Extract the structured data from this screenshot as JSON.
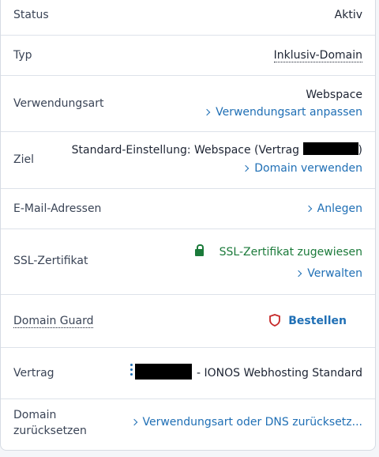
{
  "rows": {
    "status": {
      "label": "Status",
      "value": "Aktiv"
    },
    "typ": {
      "label": "Typ",
      "value": "Inklusiv-Domain"
    },
    "verwendungsart": {
      "label": "Verwendungsart",
      "value": "Webspace",
      "link": "Verwendungsart anpassen"
    },
    "ziel": {
      "label": "Ziel",
      "value_prefix": "Standard-Einstellung: Webspace (Vertrag",
      "value_suffix": ")",
      "link": "Domain verwenden"
    },
    "email": {
      "label": "E-Mail-Adressen",
      "link": "Anlegen"
    },
    "ssl": {
      "label": "SSL-Zertifikat",
      "status": "SSL-Zertifikat zugewiesen",
      "link": "Verwalten"
    },
    "guard": {
      "label": "Domain Guard",
      "link": "Bestellen"
    },
    "vertrag": {
      "label": "Vertrag",
      "value": "- IONOS Webhosting Standard"
    },
    "reset": {
      "label_line1": "Domain",
      "label_line2": "zurücksetzen",
      "link": "Verwendungsart oder DNS zurücksetz..."
    }
  },
  "icons": {
    "chevron": "chevron-right-icon",
    "lock": "lock-icon",
    "shield": "shield-icon",
    "kebab": "kebab-menu-icon"
  },
  "colors": {
    "link": "#1f6fb5",
    "success": "#1b7a3a",
    "guard": "#c62828"
  }
}
